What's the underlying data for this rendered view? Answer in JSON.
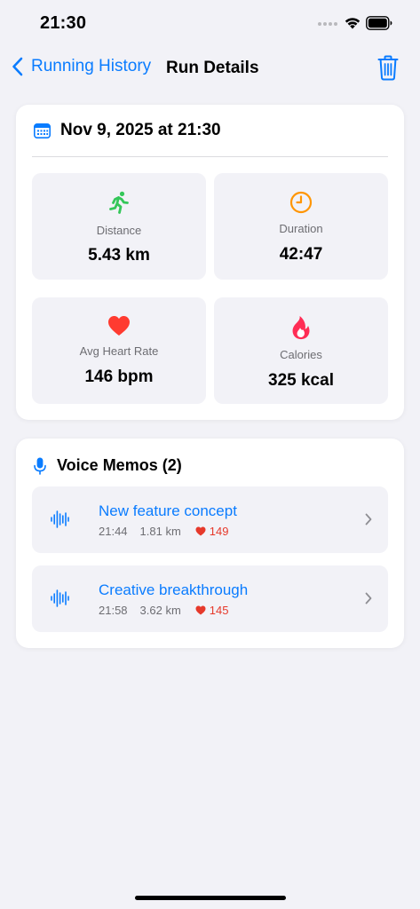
{
  "status_bar": {
    "time": "21:30"
  },
  "nav": {
    "back_label": "Running History",
    "title": "Run Details"
  },
  "run": {
    "date": "Nov 9, 2025 at 21:30",
    "stats": [
      {
        "label": "Distance",
        "value": "5.43 km",
        "icon": "runner-icon",
        "color": "#34c759"
      },
      {
        "label": "Duration",
        "value": "42:47",
        "icon": "clock-icon",
        "color": "#ff9500"
      },
      {
        "label": "Avg Heart Rate",
        "value": "146 bpm",
        "icon": "heart-icon",
        "color": "#ff3b30"
      },
      {
        "label": "Calories",
        "value": "325 kcal",
        "icon": "flame-icon",
        "color": "#ff2d55"
      }
    ]
  },
  "memos": {
    "title": "Voice Memos (2)",
    "items": [
      {
        "title": "New feature concept",
        "time": "21:44",
        "distance": "1.81 km",
        "heart_rate": "149"
      },
      {
        "title": "Creative breakthrough",
        "time": "21:58",
        "distance": "3.62 km",
        "heart_rate": "145"
      }
    ]
  },
  "colors": {
    "accent": "#0a7cff",
    "background": "#f2f2f7",
    "heart": "#e6392b"
  }
}
